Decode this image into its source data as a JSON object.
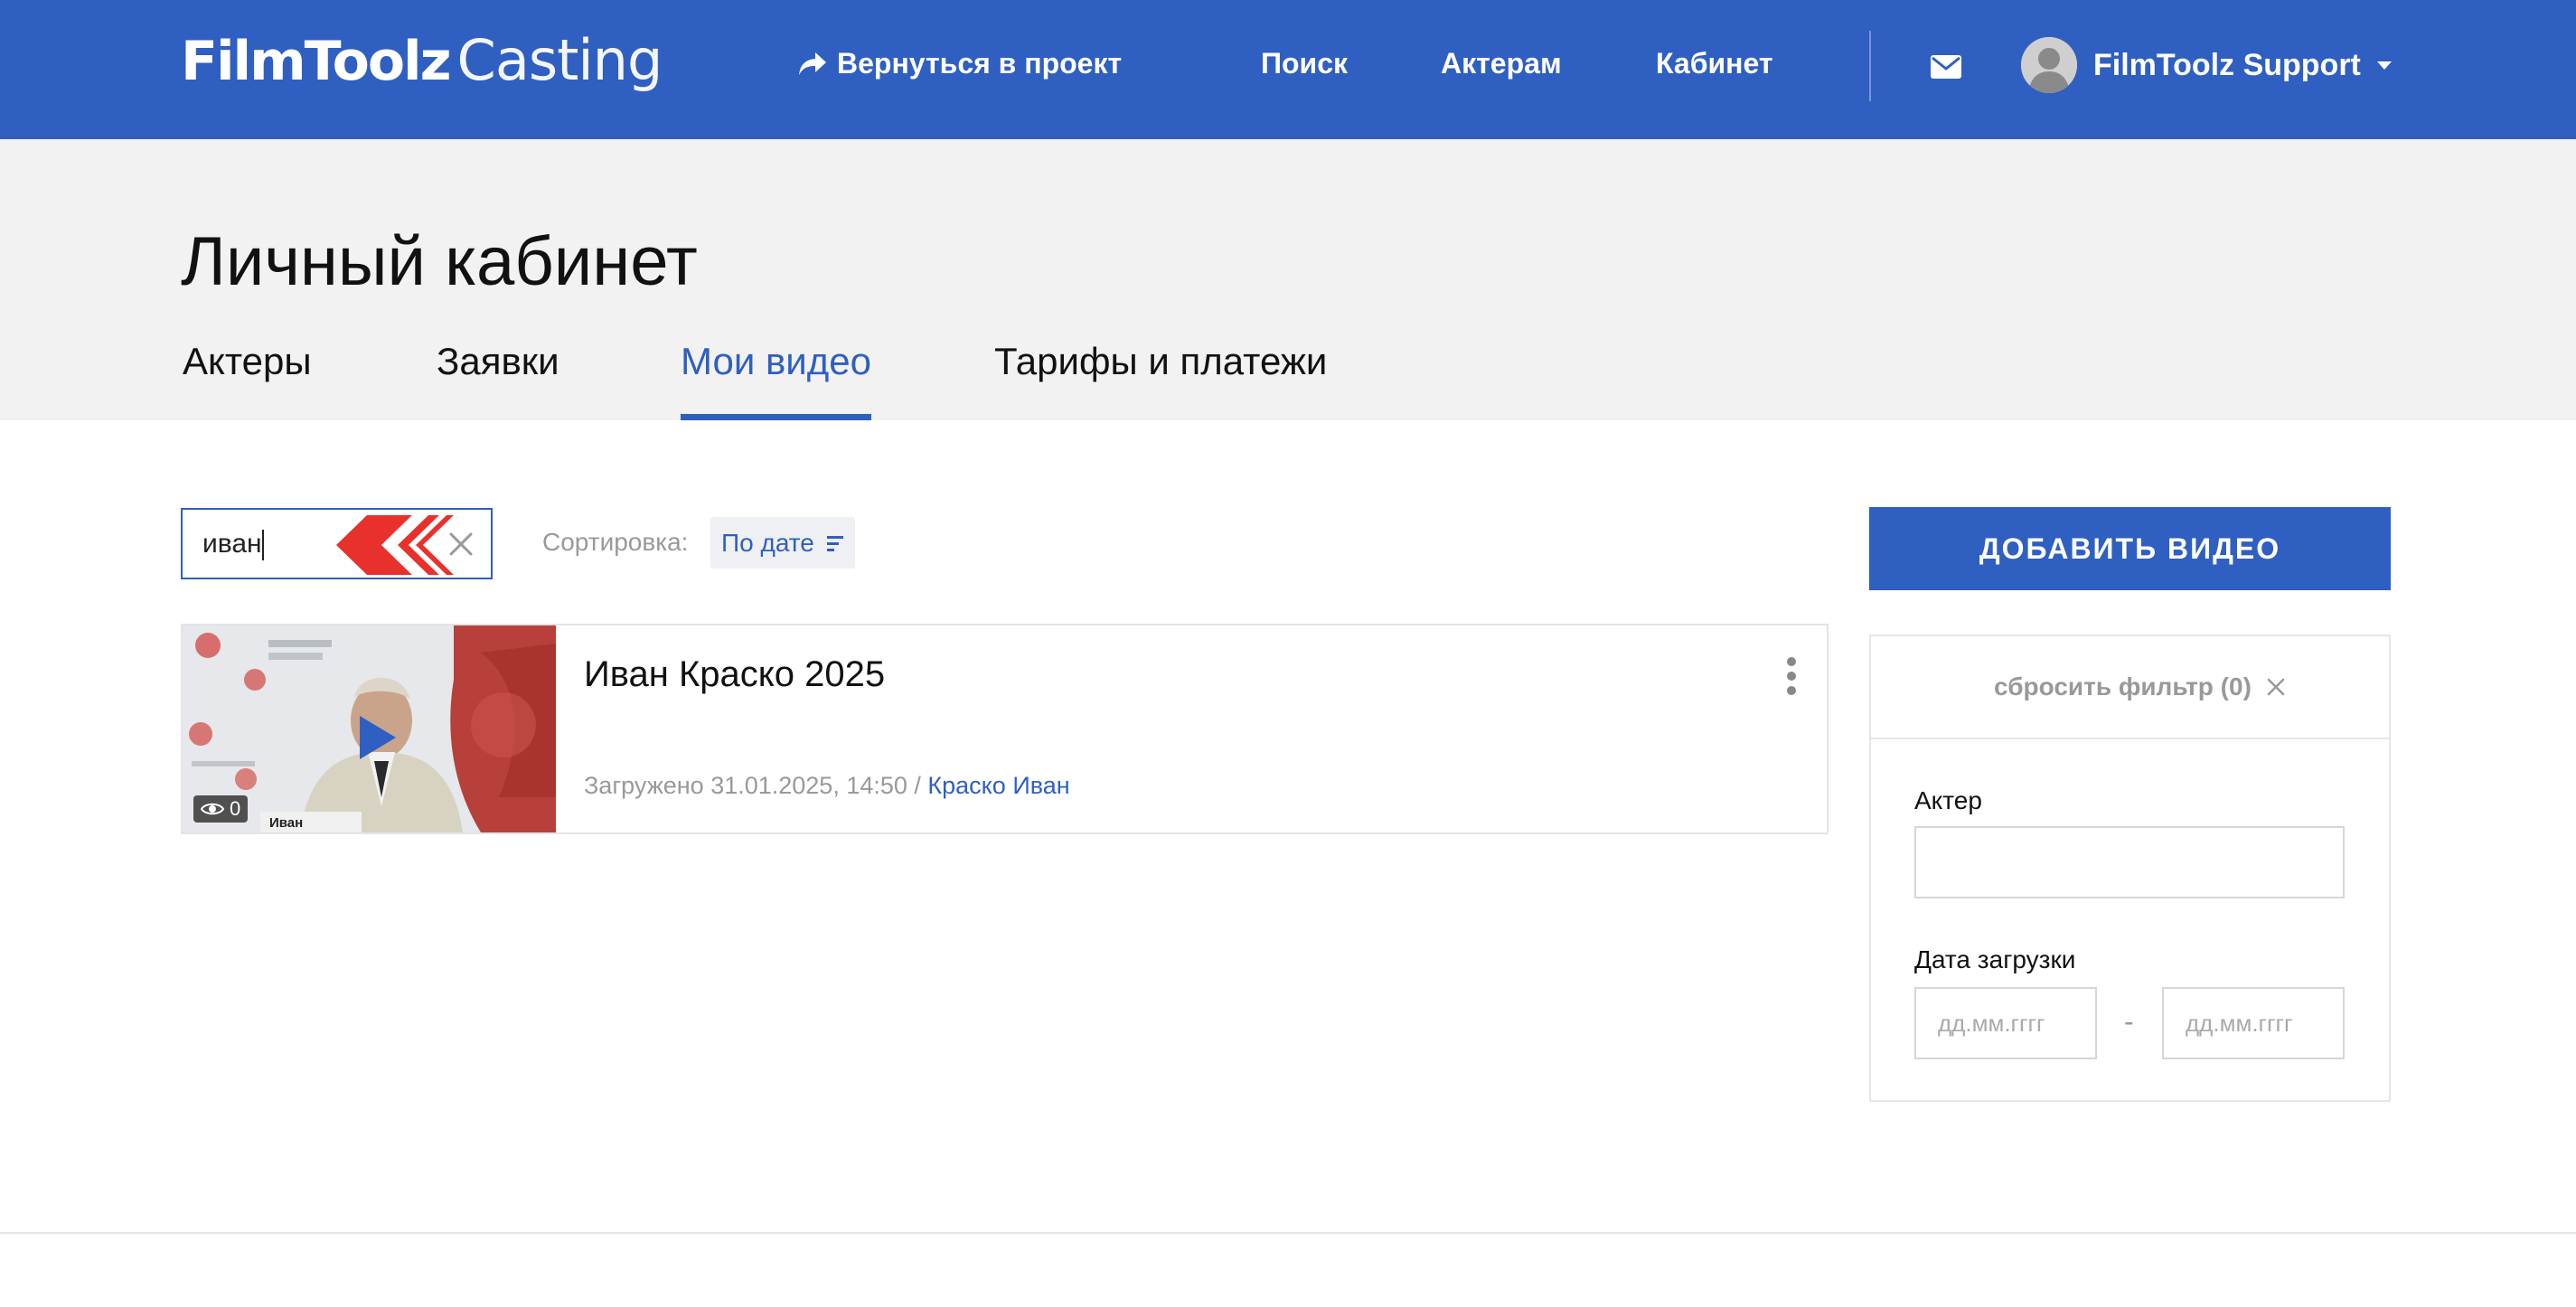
{
  "brand": {
    "logo_main": "FilmToolz",
    "logo_sub": "Casting"
  },
  "header": {
    "back_link": "Вернуться в проект",
    "nav": {
      "search": "Поиск",
      "actors": "Актерам",
      "cabinet": "Кабинет"
    },
    "user_name": "FilmToolz Support"
  },
  "page": {
    "title": "Личный кабинет",
    "tabs": [
      {
        "label": "Актеры",
        "active": false
      },
      {
        "label": "Заявки",
        "active": false
      },
      {
        "label": "Мои видео",
        "active": true
      },
      {
        "label": "Тарифы и платежи",
        "active": false
      }
    ]
  },
  "toolbar": {
    "search_value": "иван",
    "sort_label": "Сортировка:",
    "sort_value": "По дате"
  },
  "videos": [
    {
      "title": "Иван Краско 2025",
      "uploaded_prefix": "Загружено 31.01.2025, 14:50 /",
      "actor": "Краско Иван",
      "views": "0",
      "thumb_caption": "Иван"
    }
  ],
  "sidebar": {
    "add_button": "ДОБАВИТЬ ВИДЕО",
    "reset_filter": "сбросить фильтр (0)",
    "actor_label": "Актер",
    "actor_value": "",
    "date_label": "Дата загрузки",
    "date_from_placeholder": "дд.мм.гггг",
    "date_to_placeholder": "дд.мм.гггг",
    "date_separator": "-"
  },
  "colors": {
    "brand_blue": "#2f5fc0",
    "subheader_bg": "#f2f2f2",
    "muted_text": "#999999",
    "accent_red": "#e8312d"
  },
  "icons": {
    "back": "share-arrow-icon",
    "mail": "envelope-icon",
    "avatar": "user-silhouette-icon",
    "caret": "caret-down-icon",
    "clear": "close-icon",
    "arrows": "chevron-arrows-icon",
    "sort": "sort-lines-icon",
    "play": "play-icon",
    "views": "eye-icon",
    "more": "kebab-icon"
  }
}
